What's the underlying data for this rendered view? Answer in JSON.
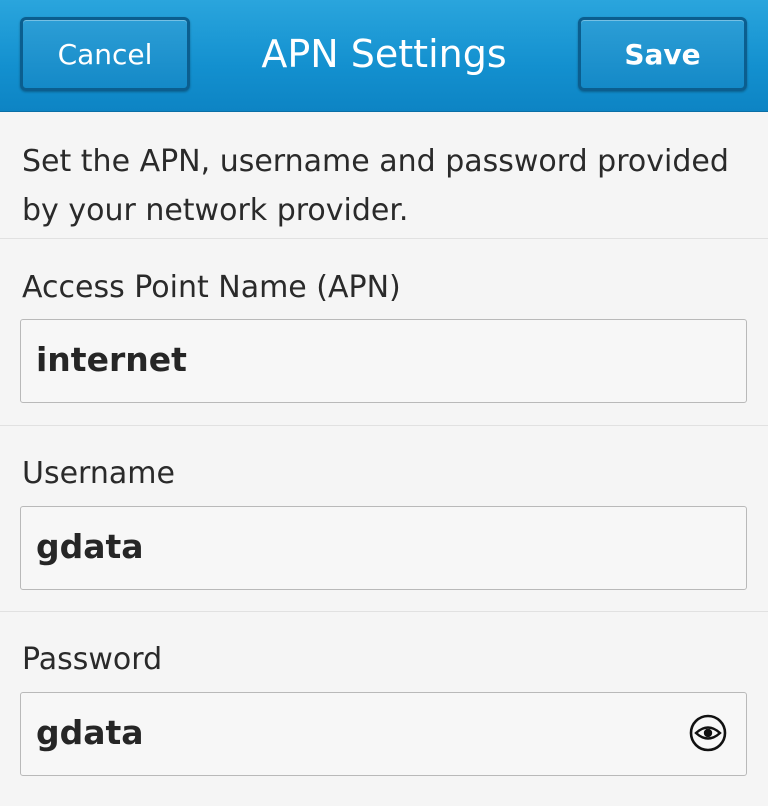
{
  "header": {
    "title": "APN Settings",
    "cancel_label": "Cancel",
    "save_label": "Save",
    "bar_color": "#1390cf"
  },
  "description": "Set the APN, username and password provided by your network provider.",
  "fields": [
    {
      "label": "Access Point Name (APN)",
      "value": "internet"
    },
    {
      "label": "Username",
      "value": "gdata"
    },
    {
      "label": "Password",
      "value": "gdata",
      "toggle_icon": "eye-icon"
    }
  ]
}
